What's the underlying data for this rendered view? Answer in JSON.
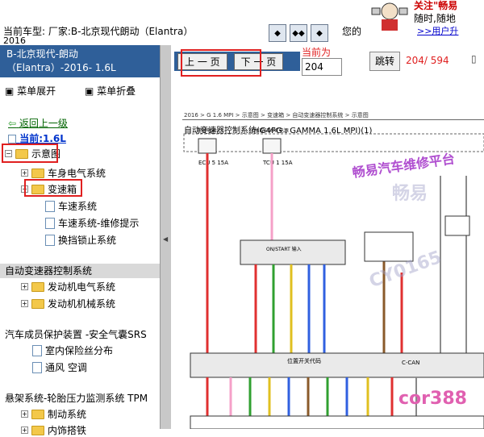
{
  "header": {
    "model_line": "当前车型:   厂家:B-北京现代朗动（Elantra）",
    "model_year": "2016",
    "truncated_text": "您的",
    "nav_icons": [
      "bookmark-icon",
      "double-page-icon",
      "page-icon"
    ]
  },
  "ad": {
    "line1": "关注\"畅易",
    "line2": "随时,随地",
    "line3": ">>用户升"
  },
  "sidebar": {
    "title_line1": "B-北京现代-朗动",
    "title_line2": "（Elantra）-2016- 1.6L",
    "expand_menu": "菜单展开",
    "collapse_menu": "菜单折叠",
    "back": "返回上一级",
    "current": "当前:1.6L",
    "tree": [
      {
        "label": "示意图",
        "type": "folder",
        "expander": "-"
      },
      {
        "label": "车身电气系统",
        "type": "folder",
        "expander": "+"
      },
      {
        "label": "变速箱",
        "type": "folder",
        "expander": "-"
      },
      {
        "label": "车速系统",
        "type": "page"
      },
      {
        "label": "车速系统-维修提示",
        "type": "page"
      },
      {
        "label": "换挡锁止系统",
        "type": "page"
      }
    ],
    "selected_category": "自动变速器控制系统",
    "tree2": [
      {
        "label": "发动机电气系统",
        "type": "folder",
        "expander": "+"
      },
      {
        "label": "发动机机械系统",
        "type": "folder",
        "expander": "+"
      }
    ],
    "category2": "汽车成员保护装置 -安全气囊SRS",
    "tree3": [
      {
        "label": "室内保险丝分布",
        "type": "page"
      },
      {
        "label": "通风 空调",
        "type": "page"
      }
    ],
    "category3": "悬架系统-轮胎压力监测系统 TPM",
    "tree4": [
      {
        "label": "制动系统",
        "type": "folder",
        "expander": "+"
      },
      {
        "label": "内饰搭铁",
        "type": "folder",
        "expander": "+"
      }
    ]
  },
  "toolbar": {
    "prev_page": "上 一 页",
    "next_page": "下 一 页",
    "current_page_label": "当前为",
    "current_page_value": "204",
    "jump": "跳转",
    "page_count": "204/ 594"
  },
  "diagram": {
    "breadcrumb": "2016 > G 1.6 MPI > 示意图 > 变速箱 > 自动变速器控制系统 > 示意图",
    "title": "自动变速器控制系统(G4FG : GAMMA 1.6L MPI)(1)",
    "fuse_labels": [
      "ECU 5 15A",
      "TCU 1 15A"
    ],
    "power_labels": [
      "常时电源",
      "ON或START电源"
    ],
    "module_label": "ON/START 输入",
    "bus_label": "C-CAN",
    "connector_label": "位置开关代码",
    "wire_colors": [
      "#e03030",
      "#e03030",
      "#f5a0c8",
      "#30a030",
      "#e0c020",
      "#3060e0",
      "#8a5a2a",
      "#30a030",
      "#3060e0"
    ],
    "watermark1": "畅易汽车维修平台",
    "watermark2": "畅易",
    "watermark3": "CY0165",
    "watermark4": "cor388"
  },
  "colors": {
    "title_bar": "#2f5f99",
    "highlight_red": "#e02020",
    "watermark_purple": "#b050d0",
    "watermark_pink": "#e060b0"
  }
}
